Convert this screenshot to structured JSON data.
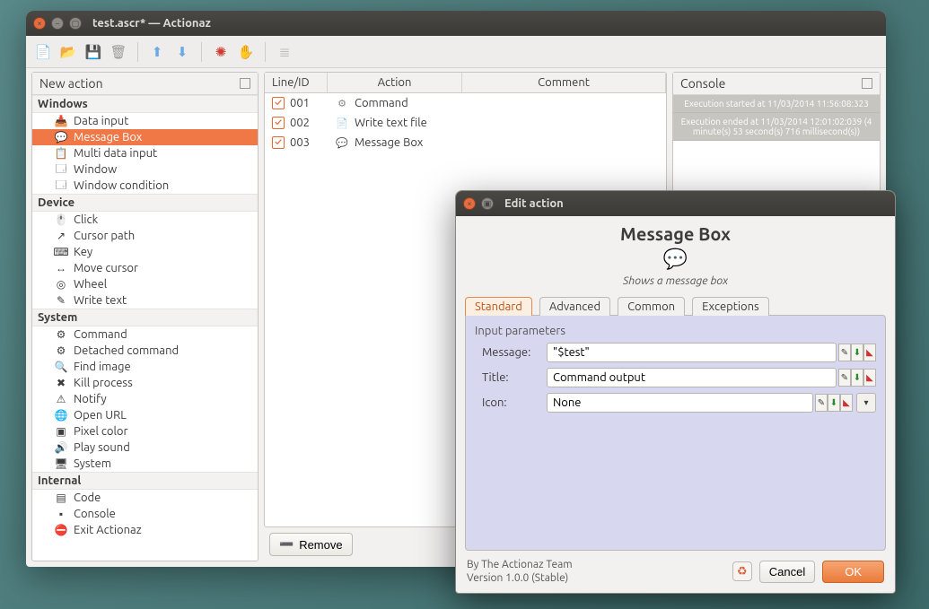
{
  "window": {
    "title": "test.ascr* — Actionaz"
  },
  "left": {
    "header": "New action",
    "groups": [
      {
        "label": "Windows",
        "items": [
          {
            "icon": "📥",
            "label": "Data input"
          },
          {
            "icon": "💬",
            "label": "Message Box",
            "selected": true
          },
          {
            "icon": "📋",
            "label": "Multi data input"
          },
          {
            "icon": "🗔",
            "label": "Window"
          },
          {
            "icon": "🗔",
            "label": "Window condition"
          }
        ]
      },
      {
        "label": "Device",
        "items": [
          {
            "icon": "🖱️",
            "label": "Click"
          },
          {
            "icon": "↗",
            "label": "Cursor path"
          },
          {
            "icon": "⌨",
            "label": "Key"
          },
          {
            "icon": "↔",
            "label": "Move cursor"
          },
          {
            "icon": "◎",
            "label": "Wheel"
          },
          {
            "icon": "✎",
            "label": "Write text"
          }
        ]
      },
      {
        "label": "System",
        "items": [
          {
            "icon": "⚙",
            "label": "Command"
          },
          {
            "icon": "⚙",
            "label": "Detached command"
          },
          {
            "icon": "🔍",
            "label": "Find image"
          },
          {
            "icon": "✖",
            "label": "Kill process"
          },
          {
            "icon": "⚠",
            "label": "Notify"
          },
          {
            "icon": "🌐",
            "label": "Open URL"
          },
          {
            "icon": "▣",
            "label": "Pixel color"
          },
          {
            "icon": "🔊",
            "label": "Play sound"
          },
          {
            "icon": "🖥",
            "label": "System"
          }
        ]
      },
      {
        "label": "Internal",
        "items": [
          {
            "icon": "▤",
            "label": "Code"
          },
          {
            "icon": "▪",
            "label": "Console"
          },
          {
            "icon": "⛔",
            "label": "Exit Actionaz"
          }
        ]
      }
    ]
  },
  "table": {
    "headers": {
      "c1": "Line/ID",
      "c2": "Action",
      "c3": "Comment"
    },
    "rows": [
      {
        "id": "001",
        "icon": "⚙",
        "action": "Command"
      },
      {
        "id": "002",
        "icon": "📄",
        "action": "Write text file"
      },
      {
        "id": "003",
        "icon": "💬",
        "action": "Message Box"
      }
    ],
    "remove": "Remove"
  },
  "console": {
    "header": "Console",
    "lines": [
      "Execution started at 11/03/2014 11:56:08:323",
      "Execution ended at 11/03/2014 12:01:02:039 (4 minute(s) 53 second(s) 716 millisecond(s))"
    ]
  },
  "dialog": {
    "titlebar": "Edit action",
    "title": "Message Box",
    "subtitle": "Shows a message box",
    "tabs": [
      "Standard",
      "Advanced",
      "Common",
      "Exceptions"
    ],
    "fieldset": "Input parameters",
    "fields": {
      "message": {
        "label": "Message:",
        "value": "\"$test\""
      },
      "title": {
        "label": "Title:",
        "value": "Command output"
      },
      "icon": {
        "label": "Icon:",
        "value": "None"
      }
    },
    "credits_line1": "By The Actionaz Team",
    "credits_line2": "Version 1.0.0 (Stable)",
    "cancel": "Cancel",
    "ok": "OK"
  }
}
